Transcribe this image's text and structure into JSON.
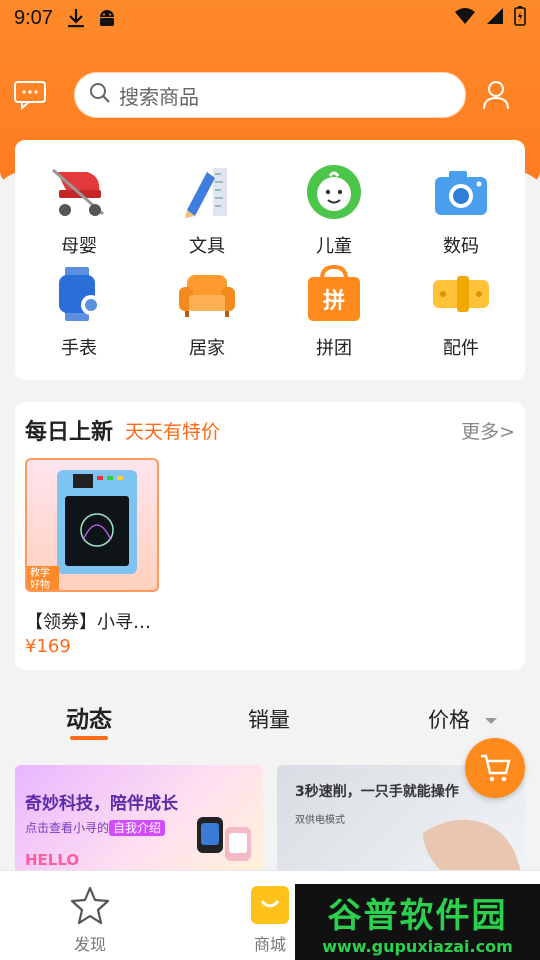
{
  "status_bar": {
    "time": "9:07"
  },
  "header": {
    "search_placeholder": "搜索商品"
  },
  "categories": [
    {
      "label": "母婴",
      "icon": "stroller-icon"
    },
    {
      "label": "文具",
      "icon": "pencil-ruler-icon"
    },
    {
      "label": "儿童",
      "icon": "child-face-icon"
    },
    {
      "label": "数码",
      "icon": "camera-icon"
    },
    {
      "label": "手表",
      "icon": "smartwatch-icon"
    },
    {
      "label": "居家",
      "icon": "sofa-icon"
    },
    {
      "label": "拼团",
      "icon": "shopping-bag-icon",
      "badge": "拼"
    },
    {
      "label": "配件",
      "icon": "band-icon"
    }
  ],
  "daily": {
    "title": "每日上新",
    "subtitle": "天天有特价",
    "more": "更多>",
    "product": {
      "name": "【领券】小寻…",
      "price": "¥169",
      "tag": "教学好物"
    }
  },
  "tabs": [
    {
      "label": "动态"
    },
    {
      "label": "销量"
    },
    {
      "label": "价格"
    }
  ],
  "feed": [
    {
      "title": "奇妙科技，陪伴成长",
      "line_prefix": "点击查看小寻的",
      "line_highlight": "自我介绍",
      "deco": "HELLO"
    },
    {
      "title": "3秒速削，一只手就能操作",
      "line": "双供电模式"
    }
  ],
  "bottom_nav": [
    {
      "label": "发现"
    },
    {
      "label": "商城"
    }
  ],
  "watermark": {
    "line1": "谷普软件园",
    "line2": "www.gupuxiazai.com"
  },
  "colors": {
    "accent": "#ff7a1f",
    "price": "#ff6a17"
  }
}
